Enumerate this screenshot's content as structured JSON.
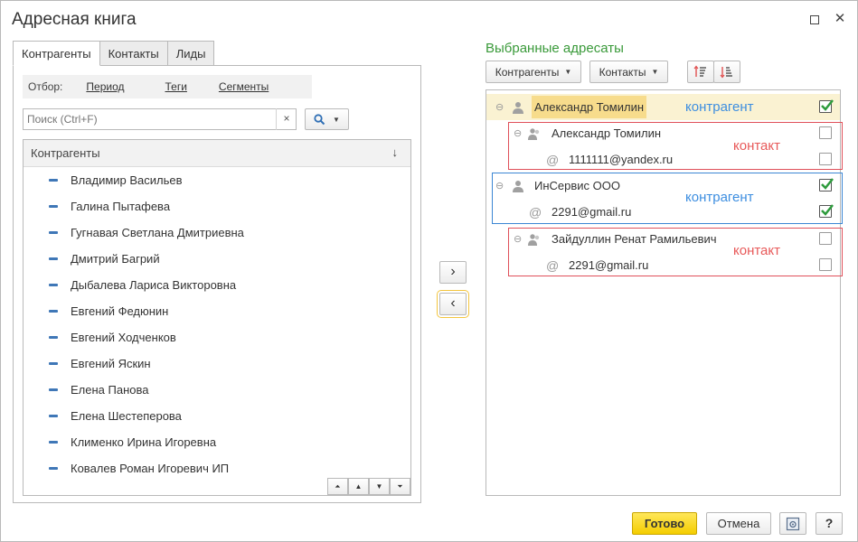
{
  "window": {
    "title": "Адресная книга",
    "maximize_glyph": "□",
    "close_glyph": "✕"
  },
  "left_tabs": [
    {
      "label": "Контрагенты",
      "active": true
    },
    {
      "label": "Контакты",
      "active": false
    },
    {
      "label": "Лиды",
      "active": false
    }
  ],
  "filter": {
    "label": "Отбор:",
    "links": [
      "Период",
      "Теги",
      "Сегменты"
    ]
  },
  "search": {
    "placeholder": "Поиск (Ctrl+F)",
    "clear_glyph": "×"
  },
  "list": {
    "header": "Контрагенты",
    "sort_glyph": "↓",
    "items": [
      "Владимир Васильев",
      "Галина Пытафева",
      "Гугнавая Светлана Дмитриевна",
      "Дмитрий Багрий",
      "Дыбалева Лариса Викторовна",
      "Евгений Федюнин",
      "Евгений Ходченков",
      "Евгений Яскин",
      "Елена Панова",
      "Елена Шестеперова",
      "Клименко Ирина Игоревна",
      "Ковалев Роман Игоревич ИП"
    ]
  },
  "middle": {
    "add_glyph": "›",
    "remove_glyph": "‹"
  },
  "right": {
    "title": "Выбранные адресаты",
    "buttons": [
      "Контрагенты",
      "Контакты"
    ],
    "rows": [
      {
        "kind": "counterparty",
        "text": "Александр Томилин",
        "checked": true,
        "selected": true
      },
      {
        "kind": "contact",
        "text": "Александр Томилин",
        "checked": false
      },
      {
        "kind": "email",
        "text": "1111111@yandex.ru",
        "checked": false
      },
      {
        "kind": "counterparty",
        "text": "ИнСервис ООО",
        "checked": true
      },
      {
        "kind": "email",
        "text": "2291@gmail.ru",
        "checked": true
      },
      {
        "kind": "contact",
        "text": "Зайдуллин Ренат Рамильевич",
        "checked": false
      },
      {
        "kind": "email",
        "text": "2291@gmail.ru",
        "checked": false
      }
    ],
    "annotations": [
      "контрагент",
      "контакт",
      "контрагент",
      "контакт"
    ],
    "colors": {
      "blue": "#3d8ee0",
      "red": "#e85a5a",
      "check": "#2d9b3c"
    }
  },
  "footer": {
    "ready": "Готово",
    "cancel": "Отмена",
    "help": "?"
  }
}
